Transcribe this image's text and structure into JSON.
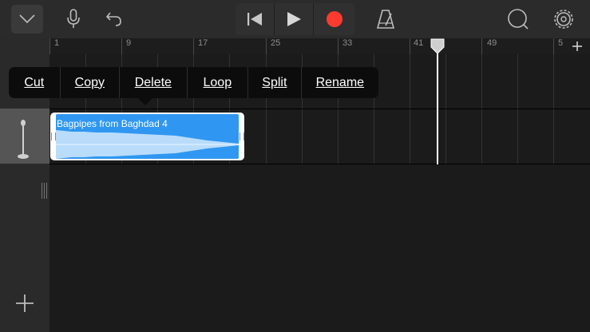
{
  "icons": {
    "tracks_view": "tracks-view-icon",
    "microphone": "microphone-icon",
    "undo": "undo-icon",
    "go_to_start": "skip-back-icon",
    "play": "play-icon",
    "record": "record-icon",
    "metronome": "metronome-icon",
    "loop_browser": "loop-browser-icon",
    "settings": "gear-icon",
    "add_section": "plus-icon",
    "add_track": "plus-icon"
  },
  "colors": {
    "record": "#ff3b30",
    "region": "#2f97f1",
    "menu_bg": "#0c0c0c"
  },
  "ruler": {
    "bars": [
      "1",
      "9",
      "17",
      "25",
      "33",
      "41",
      "49",
      "5"
    ]
  },
  "context_menu": {
    "items": [
      "Cut",
      "Copy",
      "Delete",
      "Loop",
      "Split",
      "Rename"
    ]
  },
  "region": {
    "title": "Bagpipes from Baghdad 4"
  }
}
